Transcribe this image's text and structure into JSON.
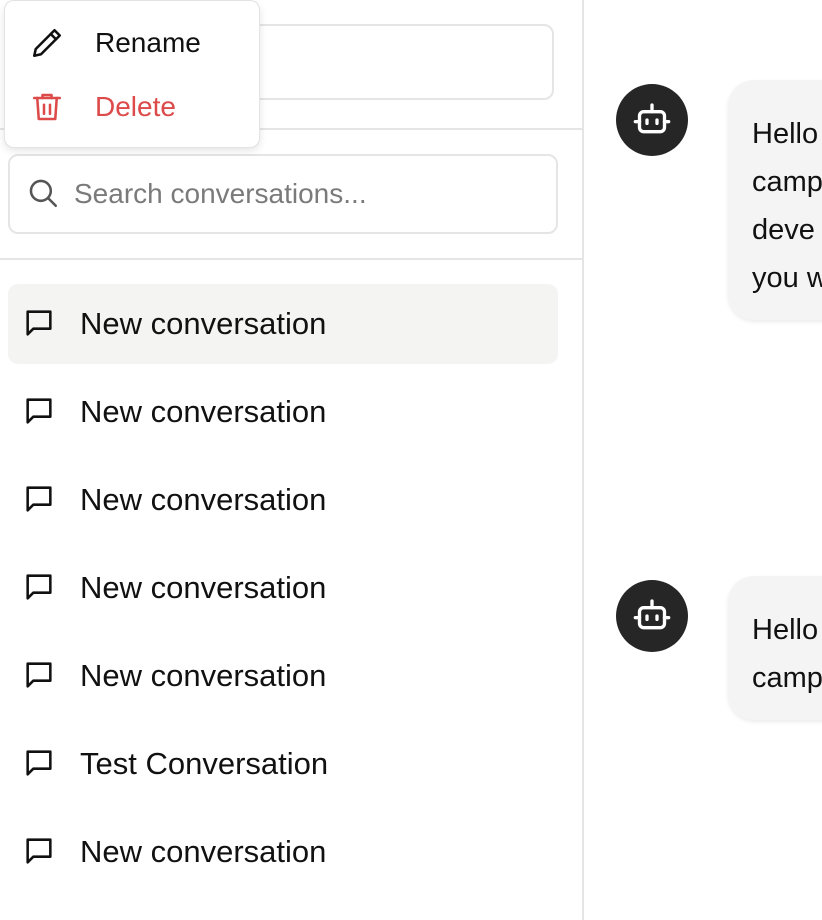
{
  "sidebar": {
    "search": {
      "placeholder": "Search conversations...",
      "value": ""
    },
    "conversations": [
      {
        "title": "New conversation",
        "active": true
      },
      {
        "title": "New conversation",
        "active": false
      },
      {
        "title": "New conversation",
        "active": false
      },
      {
        "title": "New conversation",
        "active": false
      },
      {
        "title": "New conversation",
        "active": false
      },
      {
        "title": "Test Conversation",
        "active": false
      },
      {
        "title": "New conversation",
        "active": false
      }
    ]
  },
  "context_menu": {
    "rename_label": "Rename",
    "delete_label": "Delete",
    "rename_icon": "pencil-icon",
    "delete_icon": "trash-icon"
  },
  "chat": {
    "messages": [
      {
        "sender": "assistant",
        "avatar_icon": "bot-icon",
        "lines": [
          "Hello",
          "camp",
          "deve",
          "you w"
        ]
      },
      {
        "sender": "assistant",
        "avatar_icon": "bot-icon",
        "lines": [
          "Hello",
          "camp"
        ]
      }
    ]
  },
  "colors": {
    "delete_red": "#dc4a4a",
    "active_item_bg": "#f4f4f3",
    "avatar_bg": "#262626",
    "bubble_bg": "#f4f4f5",
    "border": "#e5e5e5"
  }
}
